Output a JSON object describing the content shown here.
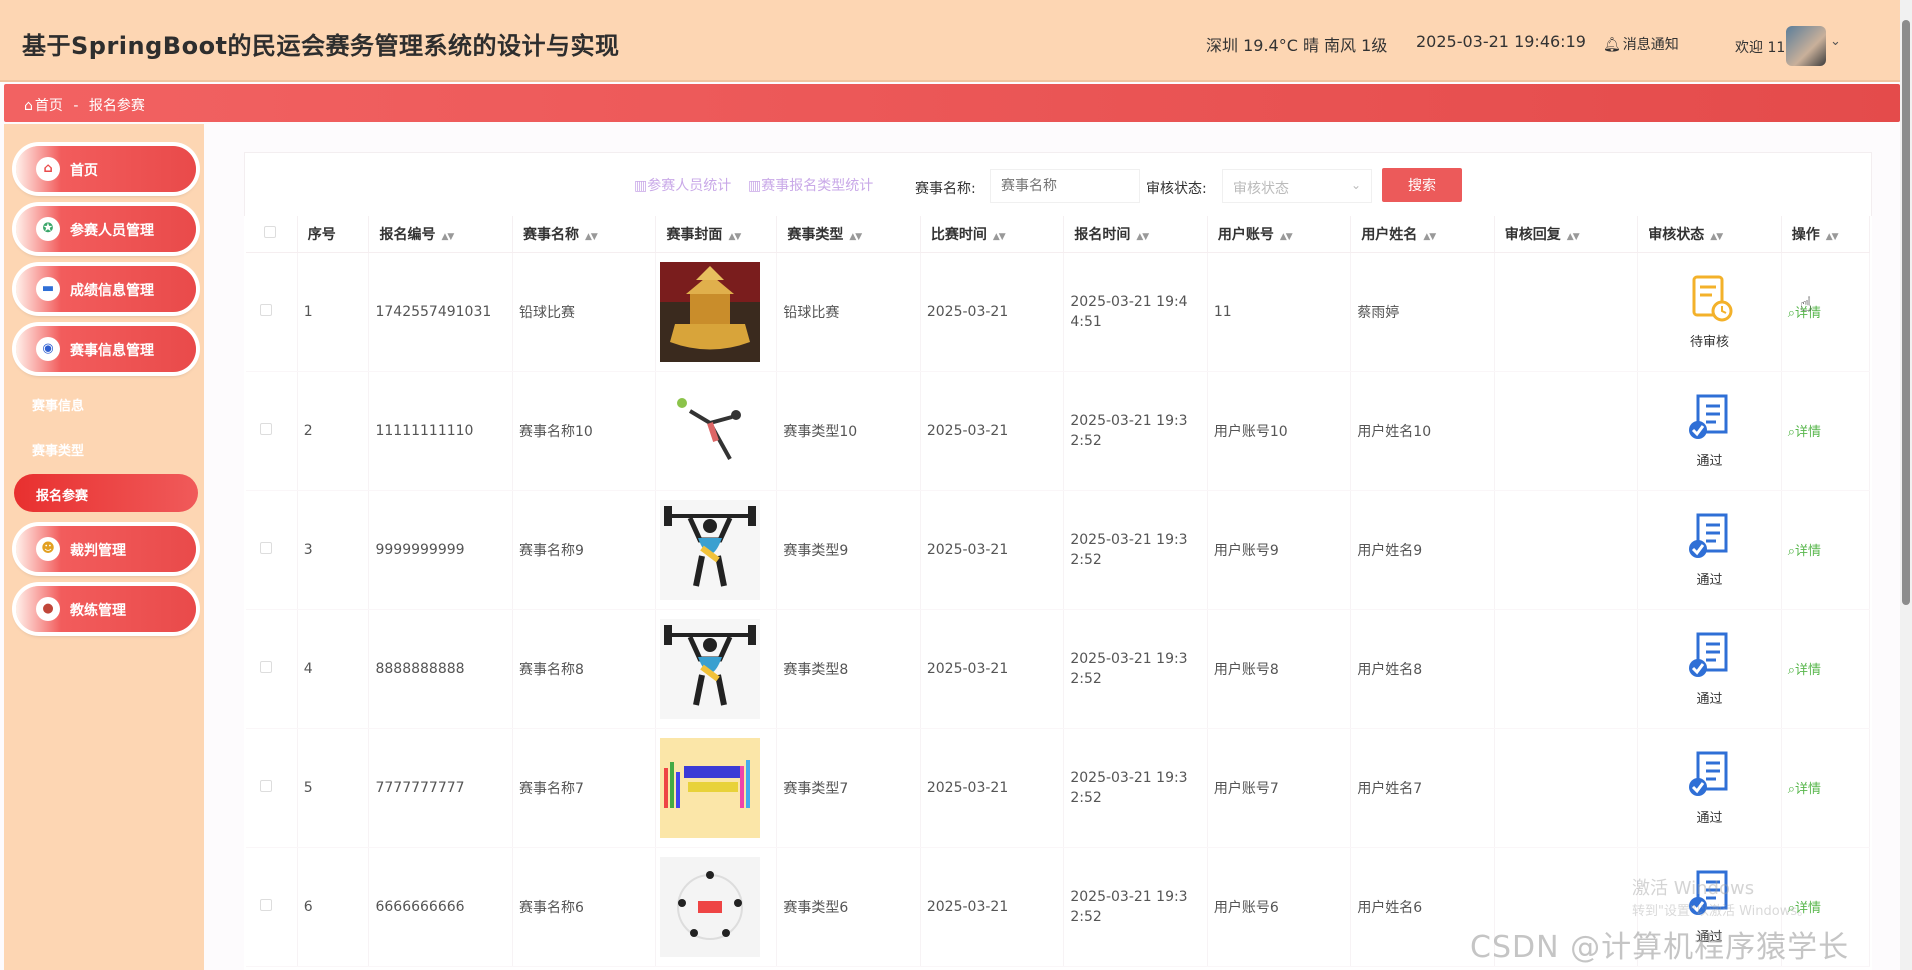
{
  "header": {
    "title": "基于SpringBoot的民运会赛务管理系统的设计与实现",
    "weather": "深圳 19.4°C 晴 南风 1级",
    "datetime": "2025-03-21 19:46:19",
    "notify": "消息通知",
    "welcome": "欢迎 11"
  },
  "breadcrumb": {
    "home": "首页",
    "sep": "-",
    "current": "报名参赛"
  },
  "sidebar": {
    "items": [
      {
        "label": "首页",
        "icon": "home-icon"
      },
      {
        "label": "参赛人员管理",
        "icon": "badge-icon"
      },
      {
        "label": "成绩信息管理",
        "icon": "monitor-icon"
      },
      {
        "label": "赛事信息管理",
        "icon": "compass-icon"
      },
      {
        "label": "裁判管理",
        "icon": "person-icon"
      },
      {
        "label": "教练管理",
        "icon": "user-icon"
      }
    ],
    "sub_items": [
      "赛事信息",
      "赛事类型",
      "报名参赛"
    ]
  },
  "toolbar": {
    "stat1": "参赛人员统计",
    "stat2": "赛事报名类型统计",
    "name_label": "赛事名称:",
    "name_placeholder": "赛事名称",
    "status_label": "审核状态:",
    "status_placeholder": "审核状态",
    "search_label": "搜索"
  },
  "table": {
    "headers": [
      "序号",
      "报名编号",
      "赛事名称",
      "赛事封面",
      "赛事类型",
      "比赛时间",
      "报名时间",
      "用户账号",
      "用户姓名",
      "审核回复",
      "审核状态",
      "操作"
    ],
    "detail_label": "详情",
    "rows": [
      {
        "no": "1",
        "code": "1742557491031",
        "name": "铅球比赛",
        "type": "铅球比赛",
        "match_time": "2025-03-21",
        "reg_time": "2025-03-21 19:44:51",
        "account": "11",
        "username": "蔡雨婷",
        "reply": "",
        "status": "待审核",
        "cover": "golden-boat"
      },
      {
        "no": "2",
        "code": "11111111110",
        "name": "赛事名称10",
        "type": "赛事类型10",
        "match_time": "2025-03-21",
        "reg_time": "2025-03-21 19:32:52",
        "account": "用户账号10",
        "username": "用户姓名10",
        "reply": "",
        "status": "通过",
        "cover": "tennis"
      },
      {
        "no": "3",
        "code": "9999999999",
        "name": "赛事名称9",
        "type": "赛事类型9",
        "match_time": "2025-03-21",
        "reg_time": "2025-03-21 19:32:52",
        "account": "用户账号9",
        "username": "用户姓名9",
        "reply": "",
        "status": "通过",
        "cover": "weightlift"
      },
      {
        "no": "4",
        "code": "8888888888",
        "name": "赛事名称8",
        "type": "赛事类型8",
        "match_time": "2025-03-21",
        "reg_time": "2025-03-21 19:32:52",
        "account": "用户账号8",
        "username": "用户姓名8",
        "reply": "",
        "status": "通过",
        "cover": "weightlift"
      },
      {
        "no": "5",
        "code": "7777777777",
        "name": "赛事名称7",
        "type": "赛事类型7",
        "match_time": "2025-03-21",
        "reg_time": "2025-03-21 19:32:52",
        "account": "用户账号7",
        "username": "用户姓名7",
        "reply": "",
        "status": "通过",
        "cover": "poster"
      },
      {
        "no": "6",
        "code": "6666666666",
        "name": "赛事名称6",
        "type": "赛事类型6",
        "match_time": "2025-03-21",
        "reg_time": "2025-03-21 19:32:52",
        "account": "用户账号6",
        "username": "用户姓名6",
        "reply": "",
        "status": "通过",
        "cover": "circle"
      }
    ]
  },
  "overlay": {
    "watermark": "CSDN @计算机程序猿学长",
    "activate": "激活 Windows",
    "activate_sub": "转到\"设置\"以激活 Windows。"
  },
  "colors": {
    "header_bg": "#fdd6b3",
    "accent": "#ec5a5a",
    "detail": "#59b74d",
    "status_blue": "#2f6fd6",
    "status_pending": "#f3b12a"
  }
}
